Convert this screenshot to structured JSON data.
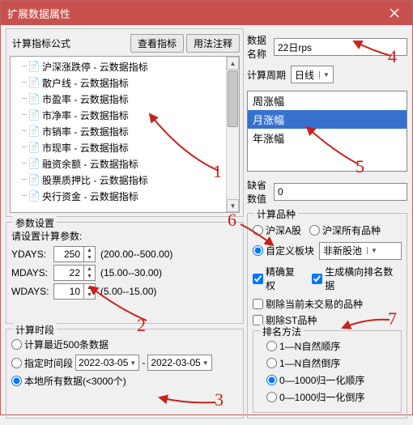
{
  "title": "扩展数据属性",
  "formula": {
    "group_label": "计算指标公式",
    "btn_view": "查看指标",
    "btn_note": "用法注释",
    "items": [
      "沪深涨跌停 - 云数据指标",
      "散户线 - 云数据指标",
      "市盈率 - 云数据指标",
      "市净率 - 云数据指标",
      "市销率 - 云数据指标",
      "市现率 - 云数据指标",
      "融资余额 - 云数据指标",
      "股票质押比 - 云数据指标",
      "央行资金 - 云数据指标"
    ]
  },
  "params": {
    "group_label": "参数设置",
    "prompt": "请设置计算参数:",
    "rows": [
      {
        "lbl": "YDAYS:",
        "val": "250",
        "range": "(200.00--500.00)"
      },
      {
        "lbl": "MDAYS:",
        "val": "22",
        "range": "(15.00--30.00)"
      },
      {
        "lbl": "WDAYS:",
        "val": "10",
        "range": "(5.00--15.00)"
      }
    ]
  },
  "period": {
    "group_label": "计算时段",
    "opt_recent": "计算最近500条数据",
    "opt_range": "指定时间段",
    "date_from": "2022-03-05",
    "date_to": "2022-03-05",
    "opt_local": "本地所有数据(<3000个)"
  },
  "name_label": "数据名称",
  "name_value": "22日rps",
  "cycle_label": "计算周期",
  "cycle_value": "日线",
  "list_items": [
    "周涨幅",
    "月涨幅",
    "年涨幅"
  ],
  "miss_label": "缺省数值",
  "miss_value": "0",
  "calc": {
    "group_label": "计算品种",
    "opt_a": "沪深A股",
    "opt_all": "沪深所有品种",
    "opt_custom": "自定义板块",
    "custom_sel": "非新股池",
    "chk_fuquan": "精确复权",
    "chk_rank": "生成横向排名数据",
    "chk_del_nontrade": "剔除当前未交易的品种",
    "chk_del_st": "剔除ST品种",
    "rank_label": "排名方法",
    "rank_opts": [
      "1—N自然顺序",
      "1—N自然倒序",
      "0—1000归一化顺序",
      "0—1000归一化倒序"
    ]
  },
  "annot": {
    "a1": "1",
    "a2": "2",
    "a3": "3",
    "a4": "4",
    "a5": "5",
    "a6": "6",
    "a7": "7"
  }
}
